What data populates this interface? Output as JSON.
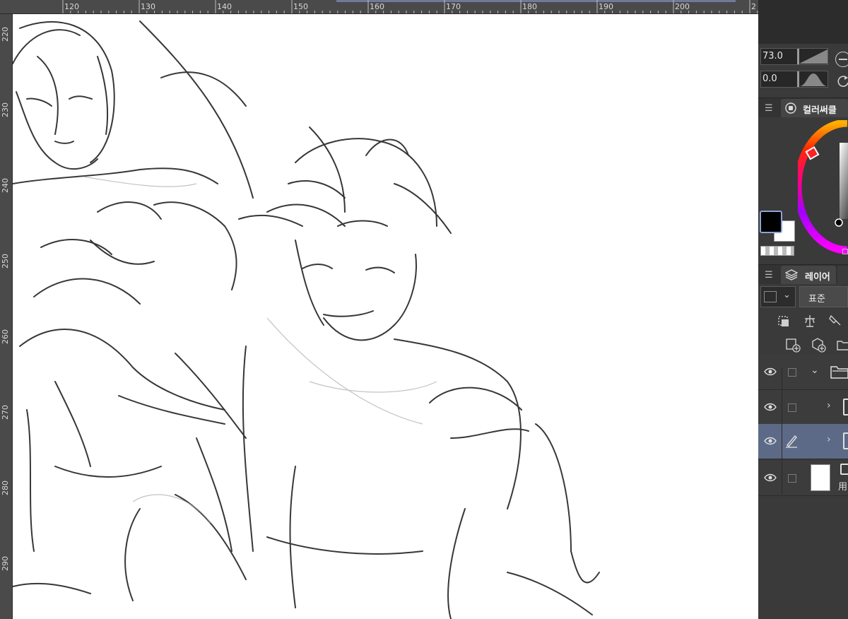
{
  "ruler": {
    "x_ticks": [
      "120",
      "130",
      "140",
      "150",
      "160",
      "170",
      "180",
      "190",
      "200",
      "2"
    ],
    "y_ticks": [
      "220",
      "230",
      "240",
      "250",
      "260",
      "270",
      "280",
      "290"
    ]
  },
  "brush": {
    "size_value": "73.0",
    "opacity_value": "0.0"
  },
  "color_panel": {
    "title": "컬러써클",
    "main_color": "#000000",
    "sub_color": "#ffffff"
  },
  "layer_panel": {
    "title": "레이어",
    "blend_mode": "표준",
    "layers": [
      {
        "kind": "folder",
        "expanded": true,
        "visible": true,
        "selected": false
      },
      {
        "kind": "layer",
        "expanded": false,
        "visible": true,
        "selected": false
      },
      {
        "kind": "layer",
        "expanded": false,
        "visible": true,
        "selected": true,
        "editing": true
      },
      {
        "kind": "paper",
        "visible": true,
        "selected": false,
        "label": "用"
      }
    ]
  },
  "colors": {
    "panel_bg": "#3a3a3a",
    "selected_layer": "#5d6a87",
    "ruler": "#4a4a4a",
    "canvas": "#ffffff"
  }
}
